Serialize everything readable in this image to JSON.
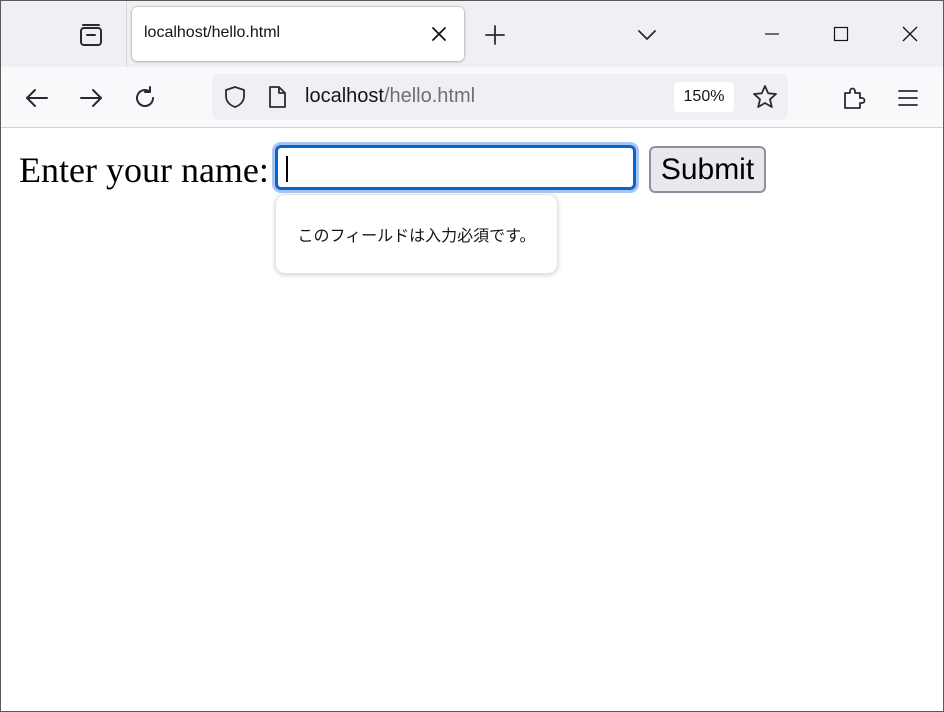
{
  "browser": {
    "tab": {
      "title": "localhost/hello.html"
    },
    "urlbar": {
      "host": "localhost",
      "path": "/hello.html",
      "zoom": "150%"
    },
    "icons": {
      "tab_overview": "tab-overview-icon",
      "tab_close": "close-icon",
      "new_tab": "plus-icon",
      "tab_list": "chevron-down-icon",
      "minimize": "minimize-icon",
      "maximize": "maximize-icon",
      "close_window": "close-window-icon",
      "back": "back-arrow-icon",
      "forward": "forward-arrow-icon",
      "reload": "reload-icon",
      "shield": "shield-icon",
      "page": "page-icon",
      "bookmark": "star-icon",
      "extensions": "puzzle-icon",
      "menu": "hamburger-menu-icon"
    }
  },
  "page": {
    "label": "Enter your name:",
    "name_input_value": "",
    "submit_label": "Submit",
    "validation_message": "このフィールドは入力必須です。"
  },
  "colors": {
    "focus_ring": "#0b62d6",
    "toolbar_bg": "#f9f9fb",
    "tabstrip_bg": "#f0f0f4"
  }
}
